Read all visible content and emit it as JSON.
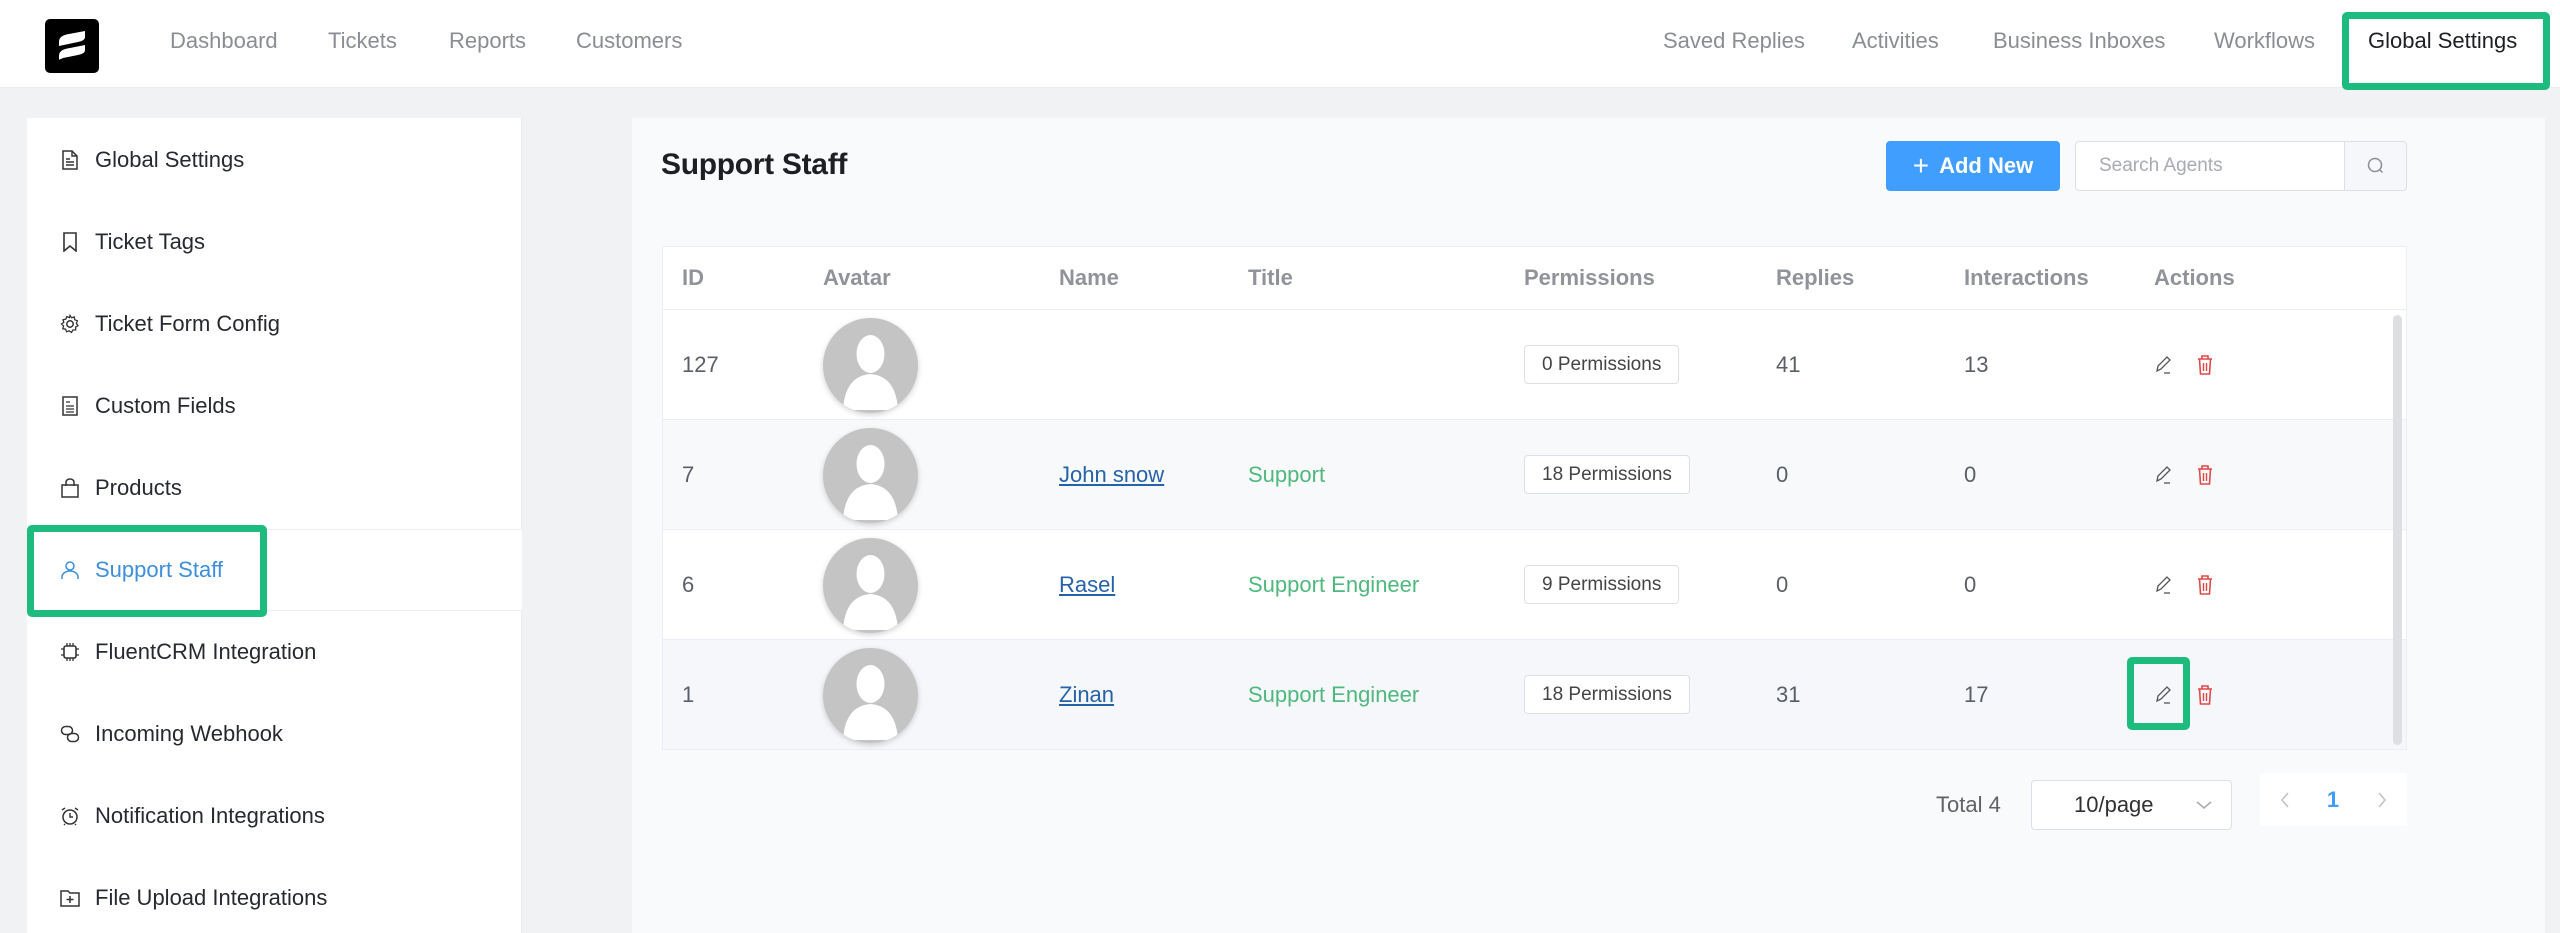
{
  "header": {
    "logo": "fluent-support-logo",
    "nav_left": [
      "Dashboard",
      "Tickets",
      "Reports",
      "Customers"
    ],
    "nav_right": [
      "Saved Replies",
      "Activities",
      "Business Inboxes",
      "Workflows",
      "Global Settings"
    ],
    "active": "Global Settings"
  },
  "sidebar": {
    "items": [
      {
        "label": "Global Settings",
        "icon": "document-icon"
      },
      {
        "label": "Ticket Tags",
        "icon": "bookmark-icon"
      },
      {
        "label": "Ticket Form Config",
        "icon": "gear-icon"
      },
      {
        "label": "Custom Fields",
        "icon": "form-icon"
      },
      {
        "label": "Products",
        "icon": "shopping-bag-icon"
      },
      {
        "label": "Support Staff",
        "icon": "user-icon"
      },
      {
        "label": "FluentCRM Integration",
        "icon": "chip-icon"
      },
      {
        "label": "Incoming Webhook",
        "icon": "link-icon"
      },
      {
        "label": "Notification Integrations",
        "icon": "alarm-clock-icon"
      },
      {
        "label": "File Upload Integrations",
        "icon": "folder-add-icon"
      }
    ],
    "active": "Support Staff"
  },
  "main": {
    "title": "Support Staff",
    "add_button": "Add New",
    "search": {
      "placeholder": "Search Agents",
      "value": ""
    },
    "table": {
      "columns": [
        "ID",
        "Avatar",
        "Name",
        "Title",
        "Permissions",
        "Replies",
        "Interactions",
        "Actions"
      ],
      "rows": [
        {
          "id": "127",
          "name": "",
          "title": "",
          "permissions": "0 Permissions",
          "replies": "41",
          "interactions": "13"
        },
        {
          "id": "7",
          "name": "John snow",
          "title": "Support",
          "permissions": "18 Permissions",
          "replies": "0",
          "interactions": "0"
        },
        {
          "id": "6",
          "name": "Rasel",
          "title": "Support Engineer",
          "permissions": "9 Permissions",
          "replies": "0",
          "interactions": "0"
        },
        {
          "id": "1",
          "name": "Zinan",
          "title": "Support Engineer",
          "permissions": "18 Permissions",
          "replies": "31",
          "interactions": "17"
        }
      ]
    },
    "pagination": {
      "total": "Total 4",
      "page_size": "10/page",
      "current_page": "1"
    }
  },
  "colors": {
    "accent": "#409eff",
    "highlight": "#1dbb7e",
    "title_green": "#4fb87d",
    "delete_red": "#e04848",
    "link_blue": "#2563a8"
  }
}
